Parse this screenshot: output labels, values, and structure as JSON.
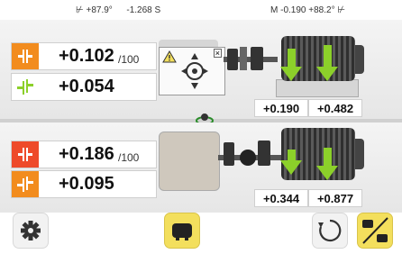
{
  "status": {
    "left_incl_angle": "+87.9°",
    "left_incl_offset": "-1.268",
    "left_incl_suffix": "S",
    "right_incl_prefix": "M",
    "right_incl_offset": "-0.190",
    "right_incl_angle": "+88.2°"
  },
  "vertical": {
    "angularity": "+0.102",
    "angularity_unit": "/100",
    "offset": "+0.054",
    "feet_front": "+0.190",
    "feet_back": "+0.482"
  },
  "horizontal": {
    "angularity": "+0.186",
    "angularity_unit": "/100",
    "offset": "+0.095",
    "feet_front": "+0.344",
    "feet_back": "+0.877"
  },
  "colors": {
    "orange": "#f28c1e",
    "red": "#ee4a2a",
    "green": "#8cd02a",
    "yellow": "#f3df5d"
  },
  "icons": [
    "settings-gear-icon",
    "machine-view-icon",
    "rotate-icon",
    "swap-machine-icon",
    "warning-icon",
    "thermometer-icon",
    "app-logo-icon"
  ]
}
